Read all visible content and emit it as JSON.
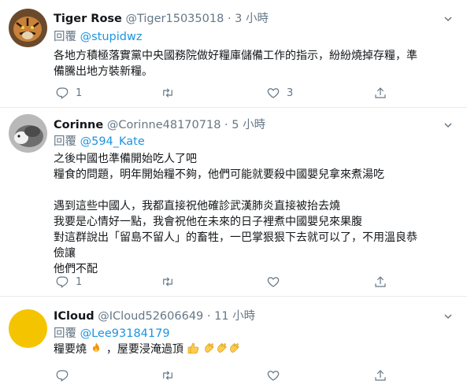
{
  "tweets": [
    {
      "name": "Tiger Rose",
      "handle": "@Tiger15035018",
      "dot": "·",
      "time": "3 小時",
      "reply_prefix": "回覆",
      "reply_to": "@stupidwz",
      "body": "各地方積極落實黨中央國務院做好糧庫儲備工作的指示，紛紛燒掉存糧，準\n備騰出地方裝新糧。",
      "replies": "1",
      "retweets": "",
      "likes": "3"
    },
    {
      "name": "Corinne",
      "handle": "@Corinne48170718",
      "dot": "·",
      "time": "5 小時",
      "reply_prefix": "回覆",
      "reply_to": "@594_Kate",
      "body": "之後中國也準備開始吃人了吧\n糧食的問題，明年開始糧不夠，他們可能就要殺中國嬰兒拿來煮湯吃\n\n遇到這些中國人，我都直接祝他確診武漢肺炎直接被抬去燒\n我要是心情好一點，我會祝他在未來的日子裡煮中國嬰兒來果腹\n對這群說出「留島不留人」的畜牲，一巴掌狠狠下去就可以了，不用溫良恭\n儉讓\n他們不配",
      "replies": "1",
      "retweets": "",
      "likes": ""
    },
    {
      "name": "ICloud",
      "handle": "@ICloud52606649",
      "dot": "·",
      "time": "11 小時",
      "reply_prefix": "回覆",
      "reply_to": "@Lee93184179",
      "body_a": "糧要燒",
      "body_b": "，屋要浸淹過頂",
      "replies": "",
      "retweets": "",
      "likes": ""
    }
  ],
  "icons": [
    "reply-icon",
    "retweet-icon",
    "like-icon",
    "share-icon",
    "chevron-down-icon",
    "fire-emoji",
    "thumbs-up-emoji",
    "clapping-hands-emoji"
  ],
  "colors": {
    "accent": "#1b95e0",
    "muted": "#657786",
    "divider": "#e6ecf0"
  }
}
